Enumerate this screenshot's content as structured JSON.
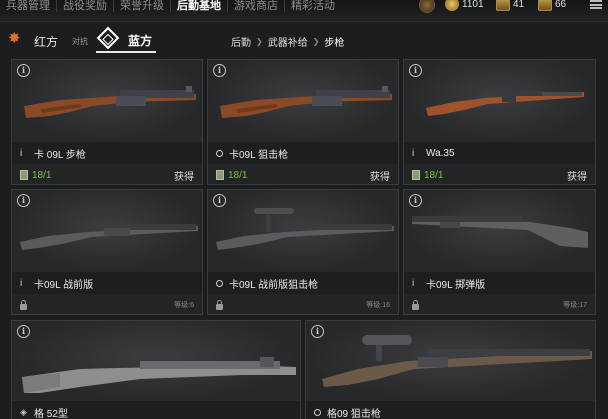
{
  "topnav": {
    "tabs": [
      {
        "label": "兵器管理",
        "active": false
      },
      {
        "label": "战役奖励",
        "active": false
      },
      {
        "label": "荣誉升级",
        "active": false
      },
      {
        "label": "后勤基地",
        "active": true
      },
      {
        "label": "游戏商店",
        "active": false
      },
      {
        "label": "精彩活动",
        "active": false
      }
    ],
    "currency": {
      "coins": "1101",
      "card_a": "41",
      "card_b": "66"
    }
  },
  "factions": {
    "red": "红方",
    "vs": "对抗",
    "blue": "蓝方",
    "selected": "blue"
  },
  "breadcrumb": [
    "后勤",
    "武器补给",
    "步枪"
  ],
  "cards": [
    {
      "name": "卡 09L 步枪",
      "bullet": "i",
      "stock": "18/1",
      "action": "获得"
    },
    {
      "name": "卡09L 狙击枪",
      "bullet": "circle",
      "stock": "18/1",
      "action": "获得"
    },
    {
      "name": "Wa.35",
      "bullet": "i",
      "stock": "18/1",
      "action": "获得"
    },
    {
      "name": "卡09L 战前版",
      "bullet": "i",
      "level": "等级:6"
    },
    {
      "name": "卡09L 战前版狙击枪",
      "bullet": "circle",
      "level": "等级:16"
    },
    {
      "name": "卡09L 掷弹版",
      "bullet": "i",
      "level": "等级:17"
    },
    {
      "name": "格 52型",
      "bullet": "diamond"
    },
    {
      "name": "格09 狙击枪",
      "bullet": "circle"
    }
  ],
  "colors": {
    "stock_green": "#7ec24a",
    "bg": "#1b1d1f",
    "card": "#26282a"
  }
}
